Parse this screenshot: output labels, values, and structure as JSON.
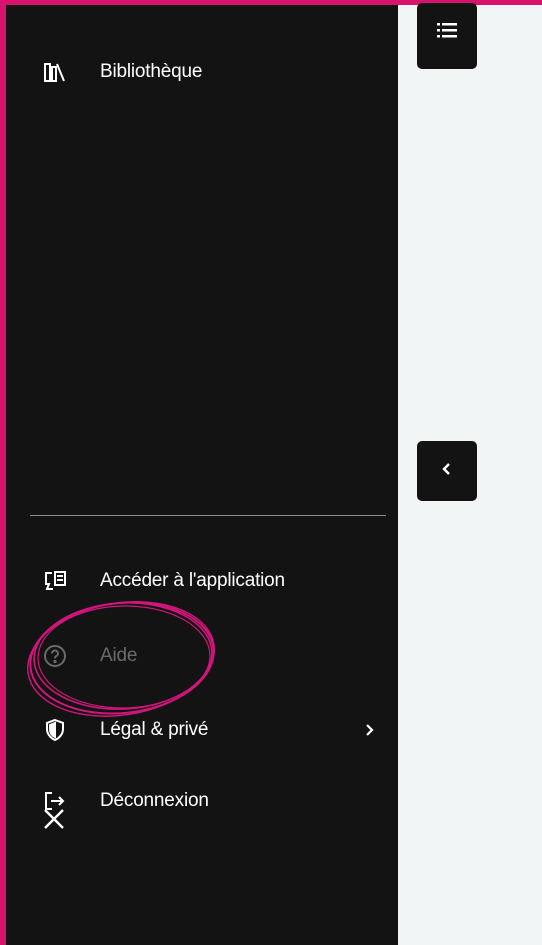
{
  "sidebar": {
    "top_item": {
      "label": "Bibliothèque",
      "icon": "library-icon"
    },
    "bottom_items": [
      {
        "label": "Accéder à l'application",
        "icon": "app-access-icon",
        "enabled": true
      },
      {
        "label": "Aide",
        "icon": "help-icon",
        "enabled": false
      },
      {
        "label": "Légal & privé",
        "icon": "shield-icon",
        "enabled": true,
        "has_submenu": true
      },
      {
        "label": "Déconnexion",
        "icon": "logout-icon",
        "enabled": true
      }
    ],
    "close_icon": "close-icon"
  },
  "main": {
    "menu_button_icon": "menu-list-icon",
    "collapse_button_icon": "chevron-left-icon"
  },
  "colors": {
    "sidebar_bg": "#131314",
    "main_bg": "#f2f5f6",
    "frame": "#d7136c",
    "annotation": "#d0167a",
    "disabled_text": "#6a6a6c"
  }
}
